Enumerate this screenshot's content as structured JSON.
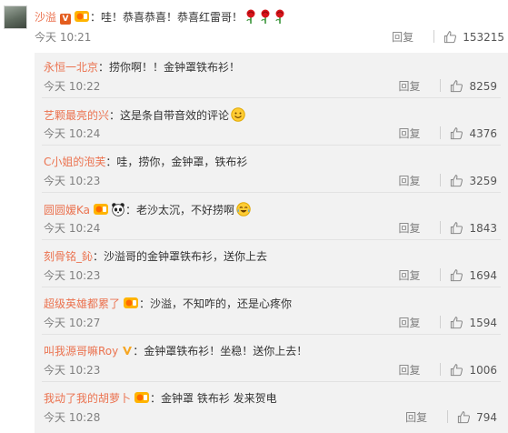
{
  "main_comment": {
    "user": "沙溢",
    "text": "：哇！恭喜恭喜！恭喜红雷哥！",
    "time": "今天 10:21",
    "reply_label": "回复",
    "likes": "153215",
    "rose_count": 3
  },
  "replies": [
    {
      "user": "永恒一北京",
      "colon": "：",
      "text": "捞你啊！！金钟罩铁布衫！",
      "time": "今天 10:22",
      "reply_label": "回复",
      "likes": "8259"
    },
    {
      "user": "艺颗最亮的兴",
      "colon": "：",
      "text": "这是条自带音效的评论",
      "time": "今天 10:24",
      "reply_label": "回复",
      "likes": "4376"
    },
    {
      "user": "C小姐的泡芙",
      "colon": "：",
      "text": "哇，捞你，金钟罩，铁布衫",
      "time": "今天 10:23",
      "reply_label": "回复",
      "likes": "3259"
    },
    {
      "user": "圆圆嫒Ka",
      "colon": "：",
      "text": "老沙太沉，不好捞啊",
      "time": "今天 10:24",
      "reply_label": "回复",
      "likes": "1843"
    },
    {
      "user": "刻骨铭_鈊",
      "colon": "：",
      "text": "沙溢哥的金钟罩铁布衫，送你上去",
      "time": "今天 10:23",
      "reply_label": "回复",
      "likes": "1694"
    },
    {
      "user": "超级英雄都累了",
      "colon": "：",
      "text": "沙溢，不知咋的，还是心疼你",
      "time": "今天 10:27",
      "reply_label": "回复",
      "likes": "1594"
    },
    {
      "user": "叫我源哥嘛Roy",
      "colon": "：",
      "text": "金钟罩铁布衫！坐稳！送你上去！",
      "time": "今天 10:23",
      "reply_label": "回复",
      "likes": "1006"
    },
    {
      "user": "我动了我的胡萝卜",
      "colon": "：",
      "text": "金钟罩 铁布衫 发来贺电",
      "time": "今天 10:28",
      "reply_label": "回复",
      "likes": "794"
    }
  ],
  "icons": {
    "like": "thumbs-up-icon",
    "verified": "verified-v-icon",
    "rose": "rose-icon",
    "emoji_smile": "smile-emoji-icon",
    "emoji_laugh_cry": "laugh-cry-emoji-icon",
    "panda": "panda-emoji-icon",
    "medal": "fan-medal-icon"
  },
  "colors": {
    "username": "#eb7350",
    "meta": "#808080",
    "reply_bg": "#f2f2f2",
    "verified_orange": "#e35d1f",
    "verified_yellow": "#f6a623"
  }
}
